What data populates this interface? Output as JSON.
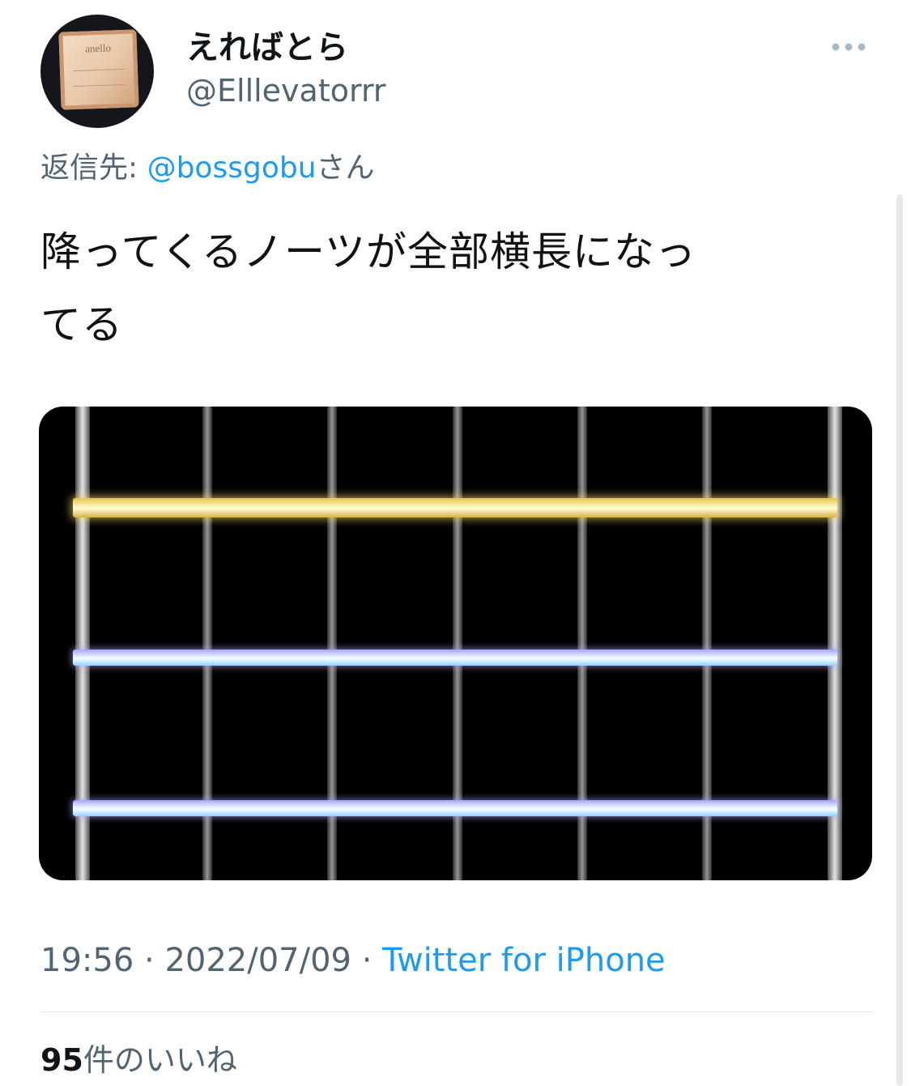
{
  "author": {
    "display_name": "えればとら",
    "handle": "@Elllevatorrr",
    "avatar_logo_text": "anello"
  },
  "more_icon": "more-horizontal-icon",
  "reply": {
    "prefix": "返信先: ",
    "target": "@bossgobu",
    "suffix": "さん"
  },
  "tweet": {
    "lines": [
      "降ってくるノーツが全部横長になっ",
      "てる"
    ]
  },
  "media": {
    "description_colors": {
      "background": "#000000",
      "yellow_note": "#fff6bd",
      "blue_note": "#e8f6ff",
      "lane": "#8d8d8d"
    }
  },
  "meta": {
    "time": "19:56",
    "separator": " · ",
    "date": "2022/07/09",
    "source": "Twitter for iPhone"
  },
  "likes": {
    "count": "95",
    "label": "件のいいね"
  },
  "colors": {
    "link": "#1d9bf0",
    "secondary_text": "#536471",
    "primary_text": "#0f1419"
  }
}
